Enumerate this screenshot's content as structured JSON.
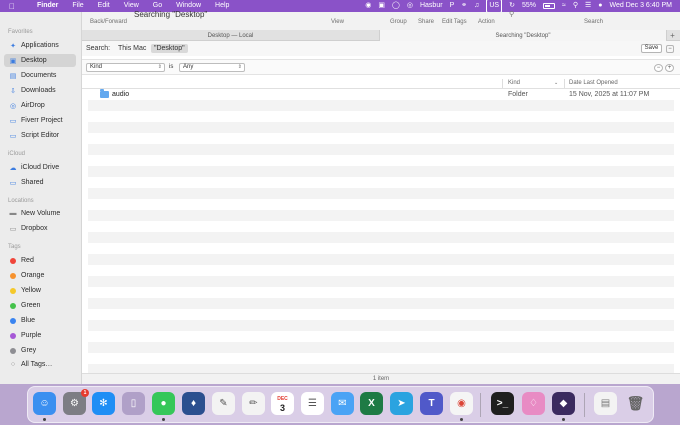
{
  "menubar": {
    "apple_icon": "apple-icon",
    "app_name": "Finder",
    "menus": [
      "File",
      "Edit",
      "View",
      "Go",
      "Window",
      "Help"
    ],
    "status_app": "Hasbur",
    "input_source": "US",
    "battery": "55%",
    "clock": "Wed Dec 3  6:40 PM"
  },
  "toolbar": {
    "title": "Searching \"Desktop\"",
    "back_forward_label": "Back/Forward",
    "view_label": "View",
    "group_label": "Group",
    "share_label": "Share",
    "edit_tags_label": "Edit Tags",
    "action_label": "Action",
    "search_label": "Search"
  },
  "tabs": {
    "tab1": "Desktop — Local",
    "tab2": "Searching \"Desktop\""
  },
  "scope": {
    "label": "Search:",
    "this_mac": "This Mac",
    "desktop": "\"Desktop\"",
    "save": "Save"
  },
  "criteria": {
    "attribute": "Kind",
    "operator": "is",
    "value": "Any"
  },
  "list": {
    "col_kind": "Kind",
    "col_date": "Date Last Opened",
    "items": [
      {
        "name": "audio",
        "kind": "Folder",
        "date": "15 Nov, 2025 at 11:07 PM"
      }
    ]
  },
  "status": "1 item",
  "sidebar": {
    "favorites_title": "Favorites",
    "favorites": [
      "Applications",
      "Desktop",
      "Documents",
      "Downloads",
      "AirDrop",
      "Fiverr Project",
      "Script Editor"
    ],
    "icloud_title": "iCloud",
    "icloud": [
      "iCloud Drive",
      "Shared"
    ],
    "locations_title": "Locations",
    "locations": [
      "New Volume",
      "Dropbox"
    ],
    "tags_title": "Tags",
    "tags": [
      {
        "name": "Red",
        "color": "#f0453a"
      },
      {
        "name": "Orange",
        "color": "#f6922e"
      },
      {
        "name": "Yellow",
        "color": "#f5c92b"
      },
      {
        "name": "Green",
        "color": "#45c24b"
      },
      {
        "name": "Blue",
        "color": "#3a84f0"
      },
      {
        "name": "Purple",
        "color": "#a658d6"
      },
      {
        "name": "Grey",
        "color": "#8e8e93"
      }
    ],
    "all_tags": "All Tags…"
  },
  "dock": {
    "calendar_month": "DEC",
    "calendar_day": "3",
    "settings_badge": "1"
  }
}
